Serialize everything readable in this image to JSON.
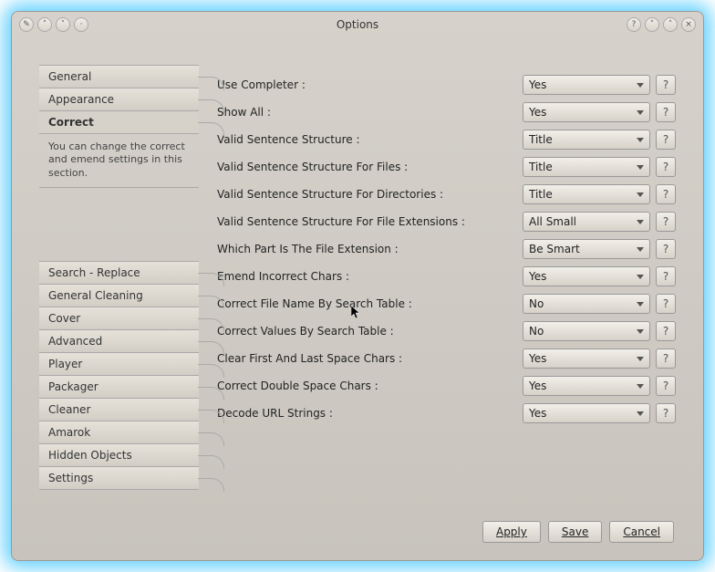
{
  "title": "Options",
  "sidebar_top": [
    {
      "label": "General",
      "id": "general"
    },
    {
      "label": "Appearance",
      "id": "appearance"
    },
    {
      "label": "Correct",
      "id": "correct",
      "active": true
    }
  ],
  "active_desc": "You can change the correct and emend settings in this section.",
  "sidebar_bottom": [
    {
      "label": "Search - Replace",
      "id": "search-replace"
    },
    {
      "label": "General Cleaning",
      "id": "general-cleaning"
    },
    {
      "label": "Cover",
      "id": "cover"
    },
    {
      "label": "Advanced",
      "id": "advanced"
    },
    {
      "label": "Player",
      "id": "player"
    },
    {
      "label": "Packager",
      "id": "packager"
    },
    {
      "label": "Cleaner",
      "id": "cleaner"
    },
    {
      "label": "Amarok",
      "id": "amarok"
    },
    {
      "label": "Hidden Objects",
      "id": "hidden-objects"
    },
    {
      "label": "Settings",
      "id": "settings"
    }
  ],
  "rows": [
    {
      "label": "Use Completer :",
      "value": "Yes",
      "id": "use-completer"
    },
    {
      "label": "Show All :",
      "value": "Yes",
      "id": "show-all"
    },
    {
      "label": "Valid Sentence Structure :",
      "value": "Title",
      "id": "valid-sentence"
    },
    {
      "label": "Valid Sentence Structure For Files :",
      "value": "Title",
      "id": "valid-sentence-files"
    },
    {
      "label": "Valid Sentence Structure For Directories :",
      "value": "Title",
      "id": "valid-sentence-dirs"
    },
    {
      "label": "Valid Sentence Structure For File Extensions :",
      "value": "All Small",
      "id": "valid-sentence-ext"
    },
    {
      "label": "Which Part Is The File Extension :",
      "value": "Be Smart",
      "id": "which-part-ext"
    },
    {
      "label": "Emend Incorrect Chars :",
      "value": "Yes",
      "id": "emend-chars"
    },
    {
      "label": "Correct File Name By Search Table :",
      "value": "No",
      "id": "correct-filename-table"
    },
    {
      "label": "Correct Values By Search Table :",
      "value": "No",
      "id": "correct-values-table"
    },
    {
      "label": "Clear First And Last Space Chars :",
      "value": "Yes",
      "id": "clear-space"
    },
    {
      "label": "Correct Double Space Chars :",
      "value": "Yes",
      "id": "correct-double-space"
    },
    {
      "label": "Decode URL Strings :",
      "value": "Yes",
      "id": "decode-url"
    }
  ],
  "buttons": {
    "apply": "Apply",
    "save": "Save",
    "cancel": "Cancel"
  },
  "help_glyph": "?"
}
